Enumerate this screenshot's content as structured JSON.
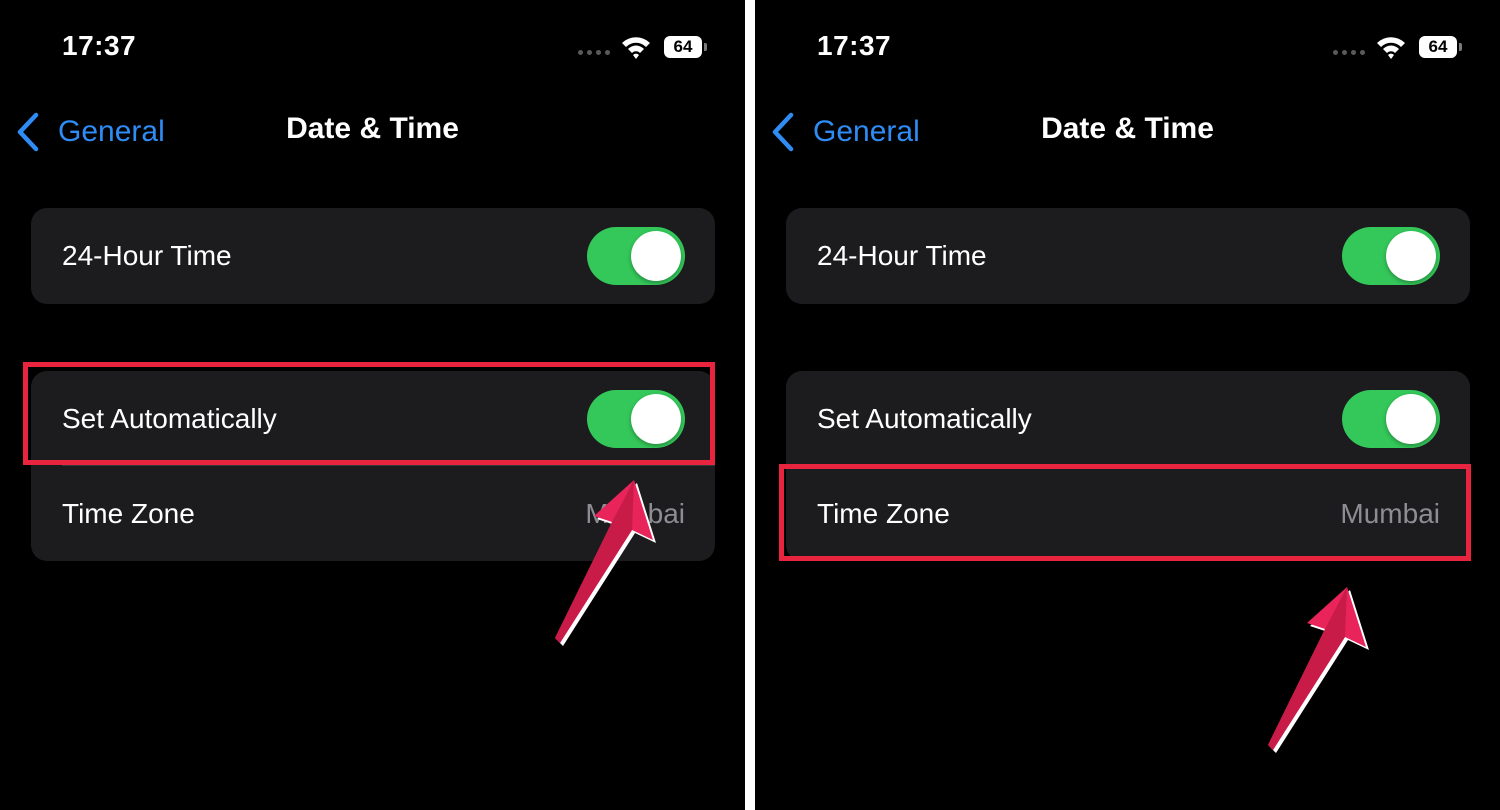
{
  "screens": [
    {
      "status": {
        "time": "17:37",
        "battery": "64"
      },
      "nav": {
        "back_label": "General",
        "title": "Date & Time"
      },
      "rows": [
        {
          "label": "24-Hour Time",
          "toggle_on": true
        },
        {
          "label": "Set Automatically",
          "toggle_on": true
        },
        {
          "label": "Time Zone",
          "value": "Mumbai"
        }
      ],
      "highlighted_row": "Set Automatically"
    },
    {
      "status": {
        "time": "17:37",
        "battery": "64"
      },
      "nav": {
        "back_label": "General",
        "title": "Date & Time"
      },
      "rows": [
        {
          "label": "24-Hour Time",
          "toggle_on": true
        },
        {
          "label": "Set Automatically",
          "toggle_on": true
        },
        {
          "label": "Time Zone",
          "value": "Mumbai"
        }
      ],
      "highlighted_row": "Time Zone"
    }
  ],
  "colors": {
    "background": "#000000",
    "cell": "#1c1c1e",
    "accent_blue": "#2f8cf5",
    "toggle_on": "#34c759",
    "highlight": "#e8243f",
    "secondary_text": "#8d8d93"
  },
  "icons": [
    "chevron-left-icon",
    "wifi-icon",
    "cellular-signal-icon",
    "battery-icon",
    "annotation-arrow-icon"
  ]
}
